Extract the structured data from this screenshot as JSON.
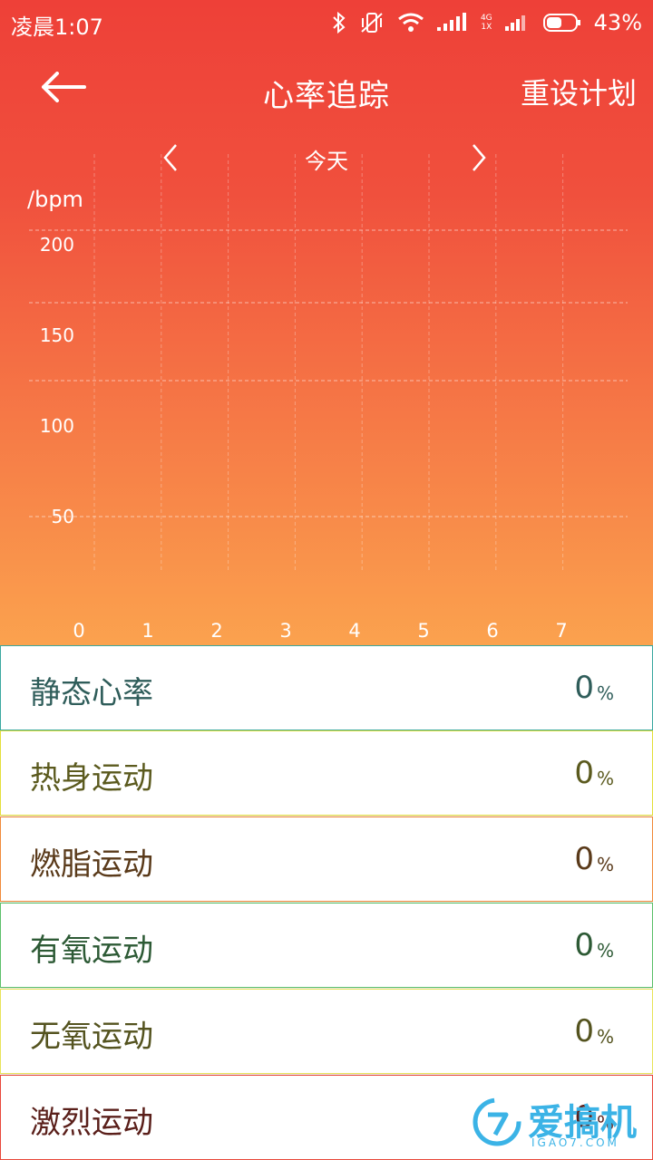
{
  "status_bar": {
    "time": "凌晨1:07",
    "battery_percent": "43%",
    "network_labels": [
      "4G",
      "1X"
    ]
  },
  "toolbar": {
    "title": "心率追踪",
    "reset_label": "重设计划"
  },
  "date_nav": {
    "label": "今天"
  },
  "chart_data": {
    "type": "line",
    "ylabel": "/bpm",
    "yticks": [
      "200",
      "150",
      "100",
      "50"
    ],
    "xticks": [
      "0",
      "1",
      "2",
      "3",
      "4",
      "5",
      "6",
      "7"
    ],
    "series": [],
    "grid": true
  },
  "zones": [
    {
      "name": "静态心率",
      "value": "0",
      "unit": "%",
      "color": "#2f5d5a",
      "border": "#3aa8a0"
    },
    {
      "name": "热身运动",
      "value": "0",
      "unit": "%",
      "color": "#5b5a1e",
      "border": "#e4df3a"
    },
    {
      "name": "燃脂运动",
      "value": "0",
      "unit": "%",
      "color": "#5a3a1a",
      "border": "#f08a3a"
    },
    {
      "name": "有氧运动",
      "value": "0",
      "unit": "%",
      "color": "#2d5a35",
      "border": "#5cc06a"
    },
    {
      "name": "无氧运动",
      "value": "0",
      "unit": "%",
      "color": "#54531f",
      "border": "#e8e35a"
    },
    {
      "name": "激烈运动",
      "value": "0",
      "unit": "%",
      "color": "#5a1f1a",
      "border": "#e8483a"
    }
  ],
  "watermark": {
    "text": "爱搞机",
    "sub": "IGAO7.COM"
  },
  "colors": {
    "gradient_top": "#ee4038",
    "gradient_bottom": "#fba24e"
  }
}
